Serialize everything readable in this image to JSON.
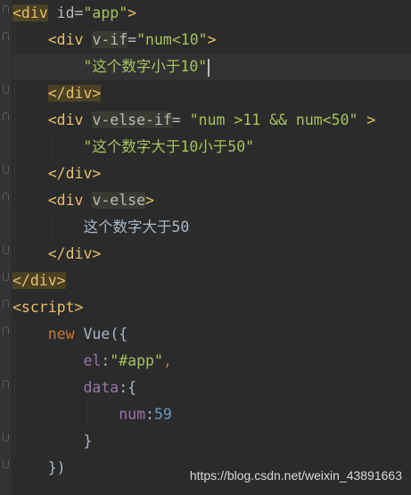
{
  "editor": {
    "lines": [
      {
        "id": "l1",
        "segments": [
          {
            "t": "<div",
            "c": "tag hl2"
          },
          {
            "t": " id=",
            "c": "attr"
          },
          {
            "t": "\"app\"",
            "c": "str"
          },
          {
            "t": ">",
            "c": "tag"
          }
        ]
      },
      {
        "id": "l2",
        "segments": [
          {
            "t": "    ",
            "c": "text"
          },
          {
            "t": "<div",
            "c": "tag"
          },
          {
            "t": " ",
            "c": "text"
          },
          {
            "t": "v-if",
            "c": "attr hl"
          },
          {
            "t": "=",
            "c": "attr"
          },
          {
            "t": "\"num<10\"",
            "c": "str"
          },
          {
            "t": ">",
            "c": "tag"
          }
        ]
      },
      {
        "id": "l3",
        "segments": [
          {
            "t": "        ",
            "c": "text"
          },
          {
            "t": "\"这个数字小于10\"",
            "c": "str"
          }
        ]
      },
      {
        "id": "l4",
        "segments": [
          {
            "t": "    ",
            "c": "text"
          },
          {
            "t": "</div>",
            "c": "tag hl2"
          }
        ]
      },
      {
        "id": "l5",
        "segments": [
          {
            "t": "    ",
            "c": "text"
          },
          {
            "t": "<div",
            "c": "tag"
          },
          {
            "t": " ",
            "c": "text"
          },
          {
            "t": "v-else-if",
            "c": "attr hl"
          },
          {
            "t": "=",
            "c": "attr"
          },
          {
            "t": " \"num >11 && num<50\" ",
            "c": "str"
          },
          {
            "t": ">",
            "c": "tag"
          }
        ]
      },
      {
        "id": "l6",
        "segments": [
          {
            "t": "        ",
            "c": "text"
          },
          {
            "t": "\"这个数字大于10小于50\"",
            "c": "str"
          }
        ]
      },
      {
        "id": "l7",
        "segments": [
          {
            "t": "    ",
            "c": "text"
          },
          {
            "t": "</div>",
            "c": "tag"
          }
        ]
      },
      {
        "id": "l8",
        "segments": [
          {
            "t": "    ",
            "c": "text"
          },
          {
            "t": "<div",
            "c": "tag"
          },
          {
            "t": " ",
            "c": "text"
          },
          {
            "t": "v-else",
            "c": "attr hl"
          },
          {
            "t": ">",
            "c": "tag"
          }
        ]
      },
      {
        "id": "l9",
        "segments": [
          {
            "t": "        ",
            "c": "text"
          },
          {
            "t": "这个数字大于50",
            "c": "text"
          }
        ]
      },
      {
        "id": "l10",
        "segments": [
          {
            "t": "    ",
            "c": "text"
          },
          {
            "t": "</div>",
            "c": "tag"
          }
        ]
      },
      {
        "id": "l11",
        "segments": [
          {
            "t": "</div>",
            "c": "tag hl2"
          }
        ]
      },
      {
        "id": "l12",
        "segments": [
          {
            "t": "<script>",
            "c": "tag"
          }
        ]
      },
      {
        "id": "l13",
        "segments": [
          {
            "t": "    ",
            "c": "text"
          },
          {
            "t": "new",
            "c": "kw"
          },
          {
            "t": " ",
            "c": "text"
          },
          {
            "t": "Vue",
            "c": "cls"
          },
          {
            "t": "({",
            "c": "punct"
          }
        ]
      },
      {
        "id": "l14",
        "segments": [
          {
            "t": "        ",
            "c": "text"
          },
          {
            "t": "el",
            "c": "prop"
          },
          {
            "t": ":",
            "c": "punct"
          },
          {
            "t": "\"#app\"",
            "c": "str"
          },
          {
            "t": ",",
            "c": "kw"
          }
        ]
      },
      {
        "id": "l15",
        "segments": [
          {
            "t": "        ",
            "c": "text"
          },
          {
            "t": "data",
            "c": "prop"
          },
          {
            "t": ":{",
            "c": "punct"
          }
        ]
      },
      {
        "id": "l16",
        "segments": [
          {
            "t": "            ",
            "c": "text"
          },
          {
            "t": "num",
            "c": "prop"
          },
          {
            "t": ":",
            "c": "punct"
          },
          {
            "t": "59",
            "c": "num"
          }
        ]
      },
      {
        "id": "l17",
        "segments": [
          {
            "t": "        ",
            "c": "text"
          },
          {
            "t": "}",
            "c": "punct"
          }
        ]
      },
      {
        "id": "l18",
        "segments": [
          {
            "t": "    ",
            "c": "text"
          },
          {
            "t": "})",
            "c": "punct"
          }
        ]
      }
    ]
  },
  "watermark": "https://blog.csdn.net/weixin_43891663",
  "icons": {
    "intention": "lightbulb-icon"
  },
  "colors": {
    "background": "#2b2b2b",
    "tag": "#e8bf6a",
    "string": "#a5c25c",
    "keyword": "#cc7832",
    "property": "#9876aa",
    "number": "#6897bb"
  }
}
